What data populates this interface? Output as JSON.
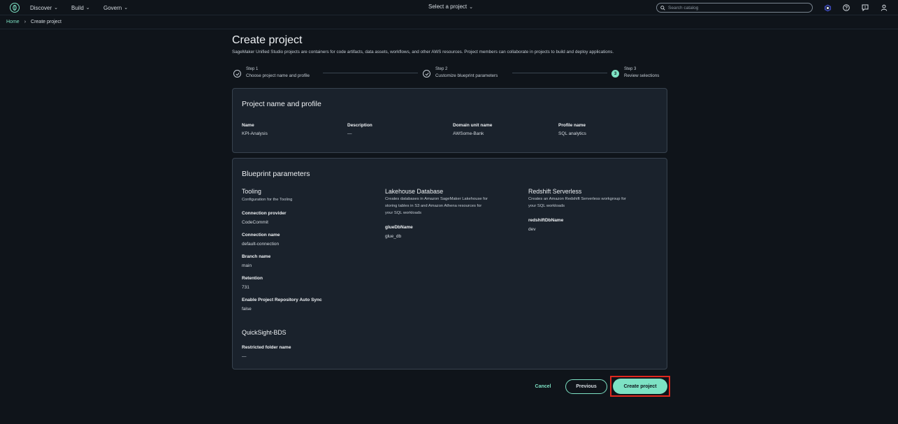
{
  "nav": {
    "menus": [
      {
        "label": "Discover"
      },
      {
        "label": "Build"
      },
      {
        "label": "Govern"
      }
    ],
    "project_selector": "Select a project",
    "search_placeholder": "Search catalog"
  },
  "breadcrumb": {
    "home": "Home",
    "current": "Create project"
  },
  "page": {
    "title": "Create project",
    "description": "SageMaker Unified Studio projects are containers for code artifacts, data assets, workflows, and other AWS resources. Project members can collaborate in projects to build and deploy applications."
  },
  "steps": [
    {
      "num": "Step 1",
      "label": "Choose project name and profile",
      "state": "complete"
    },
    {
      "num": "Step 2",
      "label": "Customize blueprint parameters",
      "state": "complete"
    },
    {
      "num": "Step 3",
      "label": "Review selections",
      "state": "current",
      "marker": "3"
    }
  ],
  "profile_card": {
    "title": "Project name and profile",
    "fields": [
      {
        "label": "Name",
        "value": "KPI-Analysis"
      },
      {
        "label": "Description",
        "value": "—"
      },
      {
        "label": "Domain unit name",
        "value": "AWSome-Bank"
      },
      {
        "label": "Profile name",
        "value": "SQL analytics"
      }
    ]
  },
  "blueprint_card": {
    "title": "Blueprint parameters",
    "tooling": {
      "title": "Tooling",
      "desc": "Configuration for the Tooling",
      "fields": [
        {
          "label": "Connection provider",
          "value": "CodeCommit"
        },
        {
          "label": "Connection name",
          "value": "default-connection"
        },
        {
          "label": "Branch name",
          "value": "main"
        },
        {
          "label": "Retention",
          "value": "731"
        },
        {
          "label": "Enable Project Repository Auto Sync",
          "value": "false"
        }
      ]
    },
    "lakehouse": {
      "title": "Lakehouse Database",
      "desc_lines": [
        "Creates databases in Amazon SageMaker Lakehouse for",
        "storing tables in S3 and Amazon Athena resources for",
        "your SQL workloads"
      ],
      "fields": [
        {
          "label": "glueDbName",
          "value": "glue_db"
        }
      ]
    },
    "redshift": {
      "title": "Redshift Serverless",
      "desc_lines": [
        "Creates an Amazon Redshift Serverless workgroup for",
        "your SQL workloads"
      ],
      "fields": [
        {
          "label": "redshiftDbName",
          "value": "dev"
        }
      ]
    },
    "quicksight": {
      "title": "QuickSight-BDS",
      "fields": [
        {
          "label": "Restricted folder name",
          "value": "—"
        }
      ]
    }
  },
  "actions": {
    "cancel": "Cancel",
    "previous": "Previous",
    "create": "Create project"
  },
  "colors": {
    "accent": "#7de2c4",
    "background": "#0f141a",
    "card": "#1a222c",
    "highlight": "#e0281e"
  }
}
